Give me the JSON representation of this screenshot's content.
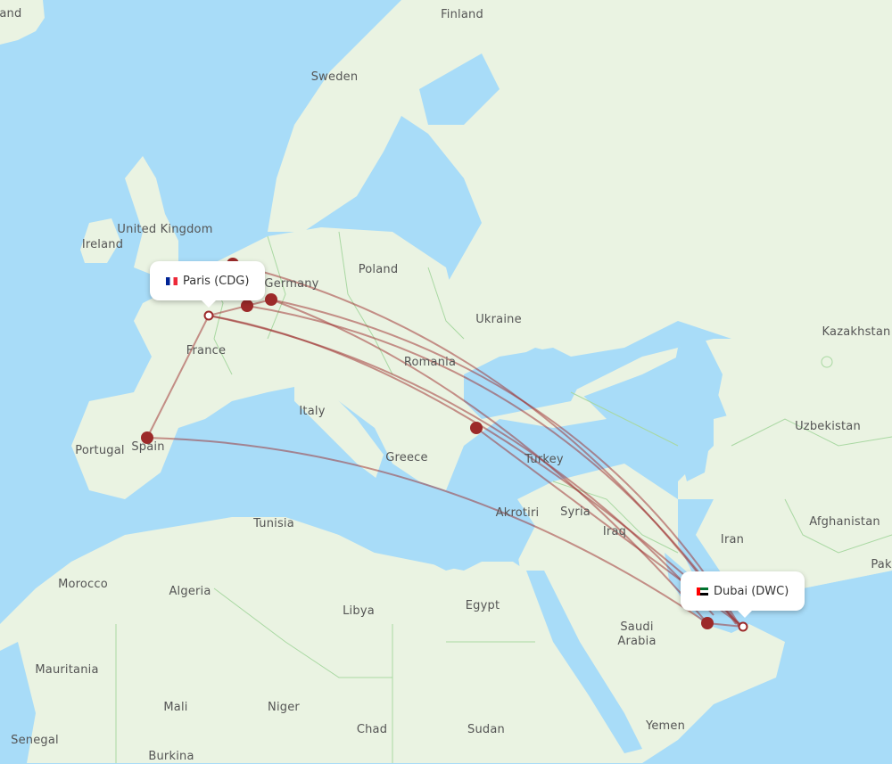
{
  "map": {
    "colors": {
      "water": "#a8dcf8",
      "land": "#eaf3e2",
      "border": "#a9d8a2",
      "route": "#9c2a2a",
      "marker": "#9c2a2a"
    },
    "origin": {
      "name": "Paris (CDG)",
      "flag": "france-flag"
    },
    "destination": {
      "name": "Dubai (DWC)",
      "flag": "uae-flag"
    },
    "labels": [
      {
        "text": "land",
        "id": "iceland"
      },
      {
        "text": "Finland",
        "id": "finland"
      },
      {
        "text": "Sweden",
        "id": "sweden"
      },
      {
        "text": "United Kingdom",
        "id": "uk"
      },
      {
        "text": "Ireland",
        "id": "ireland"
      },
      {
        "text": "Poland",
        "id": "poland"
      },
      {
        "text": "Germany",
        "id": "germany"
      },
      {
        "text": "Ukraine",
        "id": "ukraine"
      },
      {
        "text": "Kazakhstan",
        "id": "kazakhstan"
      },
      {
        "text": "France",
        "id": "france"
      },
      {
        "text": "Romania",
        "id": "romania"
      },
      {
        "text": "Italy",
        "id": "italy"
      },
      {
        "text": "Uzbekistan",
        "id": "uzbekistan"
      },
      {
        "text": "Portugal",
        "id": "portugal"
      },
      {
        "text": "Spain",
        "id": "spain"
      },
      {
        "text": "Greece",
        "id": "greece"
      },
      {
        "text": "Turkey",
        "id": "turkey"
      },
      {
        "text": "Akrotiri",
        "id": "akrotiri"
      },
      {
        "text": "Syria",
        "id": "syria"
      },
      {
        "text": "Tunisia",
        "id": "tunisia"
      },
      {
        "text": "Iraq",
        "id": "iraq"
      },
      {
        "text": "Iran",
        "id": "iran"
      },
      {
        "text": "Afghanistan",
        "id": "afghanistan"
      },
      {
        "text": "Pak",
        "id": "pakistan"
      },
      {
        "text": "Morocco",
        "id": "morocco"
      },
      {
        "text": "Algeria",
        "id": "algeria"
      },
      {
        "text": "Libya",
        "id": "libya"
      },
      {
        "text": "Egypt",
        "id": "egypt"
      },
      {
        "text": "Saudi\nArabia",
        "id": "saudi-arabia"
      },
      {
        "text": "Mauritania",
        "id": "mauritania"
      },
      {
        "text": "Mali",
        "id": "mali"
      },
      {
        "text": "Niger",
        "id": "niger"
      },
      {
        "text": "Chad",
        "id": "chad"
      },
      {
        "text": "Sudan",
        "id": "sudan"
      },
      {
        "text": "Yemen",
        "id": "yemen"
      },
      {
        "text": "Senegal",
        "id": "senegal"
      },
      {
        "text": "Burkina",
        "id": "burkina"
      }
    ]
  }
}
